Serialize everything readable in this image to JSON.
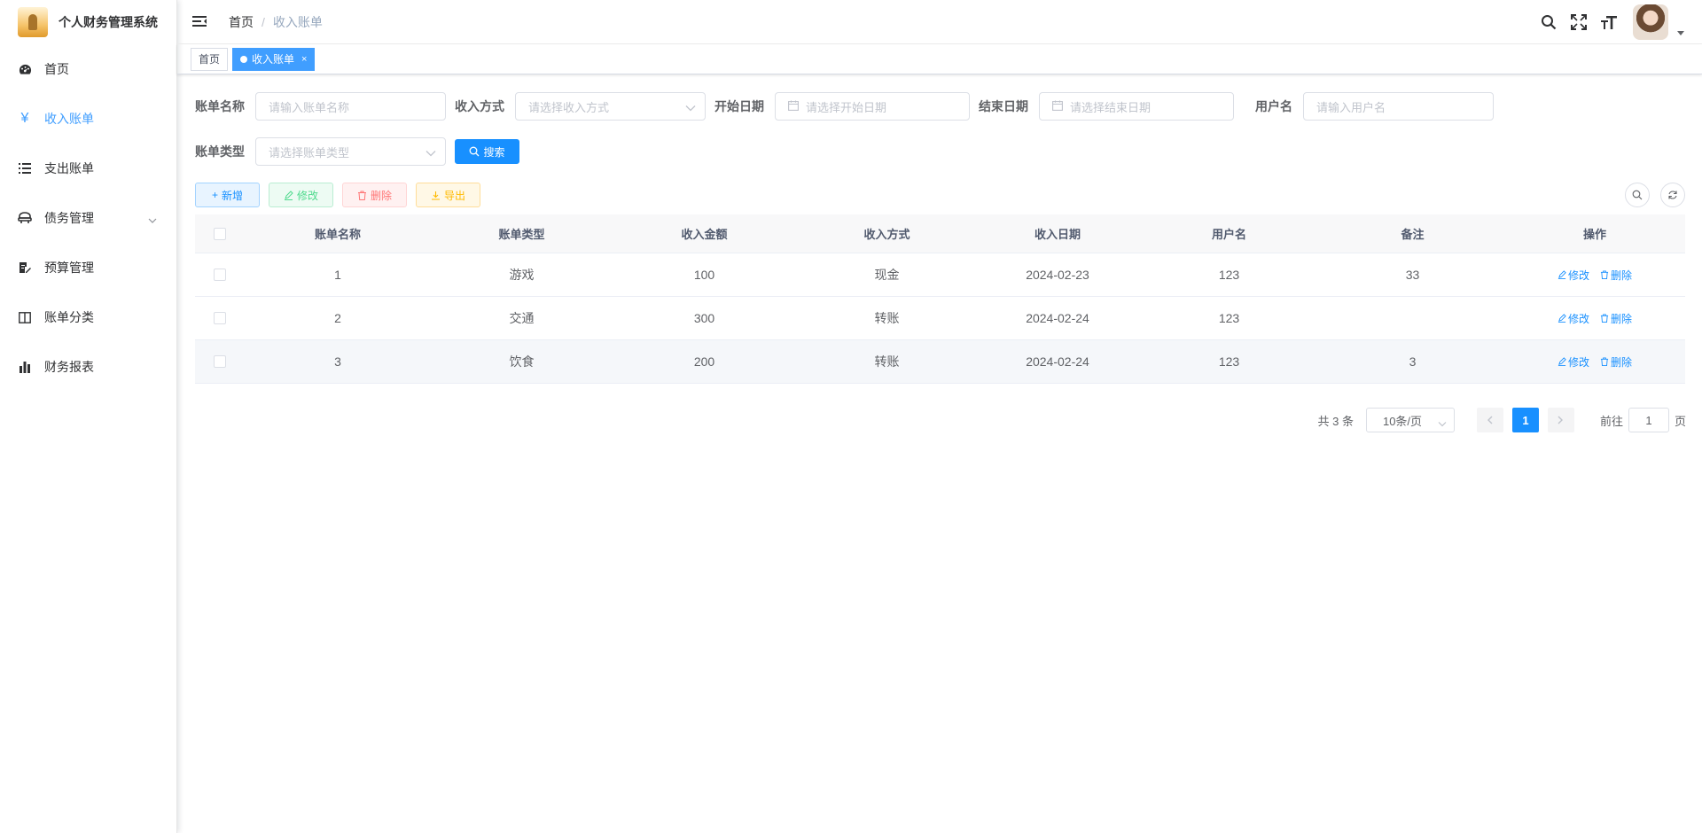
{
  "app": {
    "title": "个人财务管理系统"
  },
  "sidebar": {
    "items": [
      {
        "label": "首页",
        "icon": "dashboard-icon"
      },
      {
        "label": "收入账单",
        "icon": "yen-icon"
      },
      {
        "label": "支出账单",
        "icon": "list-icon"
      },
      {
        "label": "债务管理",
        "icon": "debt-icon"
      },
      {
        "label": "预算管理",
        "icon": "edit-doc-icon"
      },
      {
        "label": "账单分类",
        "icon": "book-icon"
      },
      {
        "label": "财务报表",
        "icon": "bar-chart-icon"
      }
    ]
  },
  "header": {
    "breadcrumb_home": "首页",
    "breadcrumb_sep": "/",
    "breadcrumb_current": "收入账单"
  },
  "tags": {
    "home": "首页",
    "current": "收入账单",
    "close": "×"
  },
  "form": {
    "bill_name_label": "账单名称",
    "bill_name_placeholder": "请输入账单名称",
    "method_label": "收入方式",
    "method_placeholder": "请选择收入方式",
    "start_label": "开始日期",
    "start_placeholder": "请选择开始日期",
    "end_label": "结束日期",
    "end_placeholder": "请选择结束日期",
    "user_label": "用户名",
    "user_placeholder": "请输入用户名",
    "type_label": "账单类型",
    "type_placeholder": "请选择账单类型",
    "search_label": "搜索"
  },
  "toolbar": {
    "add_label": "新增",
    "edit_label": "修改",
    "delete_label": "删除",
    "export_label": "导出"
  },
  "table": {
    "headers": [
      "账单名称",
      "账单类型",
      "收入金额",
      "收入方式",
      "收入日期",
      "用户名",
      "备注",
      "操作"
    ],
    "rows": [
      {
        "name": "1",
        "type": "游戏",
        "amount": "100",
        "method": "现金",
        "date": "2024-02-23",
        "user": "123",
        "note": "33"
      },
      {
        "name": "2",
        "type": "交通",
        "amount": "300",
        "method": "转账",
        "date": "2024-02-24",
        "user": "123",
        "note": ""
      },
      {
        "name": "3",
        "type": "饮食",
        "amount": "200",
        "method": "转账",
        "date": "2024-02-24",
        "user": "123",
        "note": "3"
      }
    ],
    "op_edit": "修改",
    "op_delete": "删除"
  },
  "pagination": {
    "total": "共 3 条",
    "page_size": "10条/页",
    "current_page": "1",
    "goto_label": "前往",
    "goto_value": "1",
    "page_suffix": "页"
  },
  "colors": {
    "primary": "#1890ff",
    "active_menu": "#409eff"
  }
}
